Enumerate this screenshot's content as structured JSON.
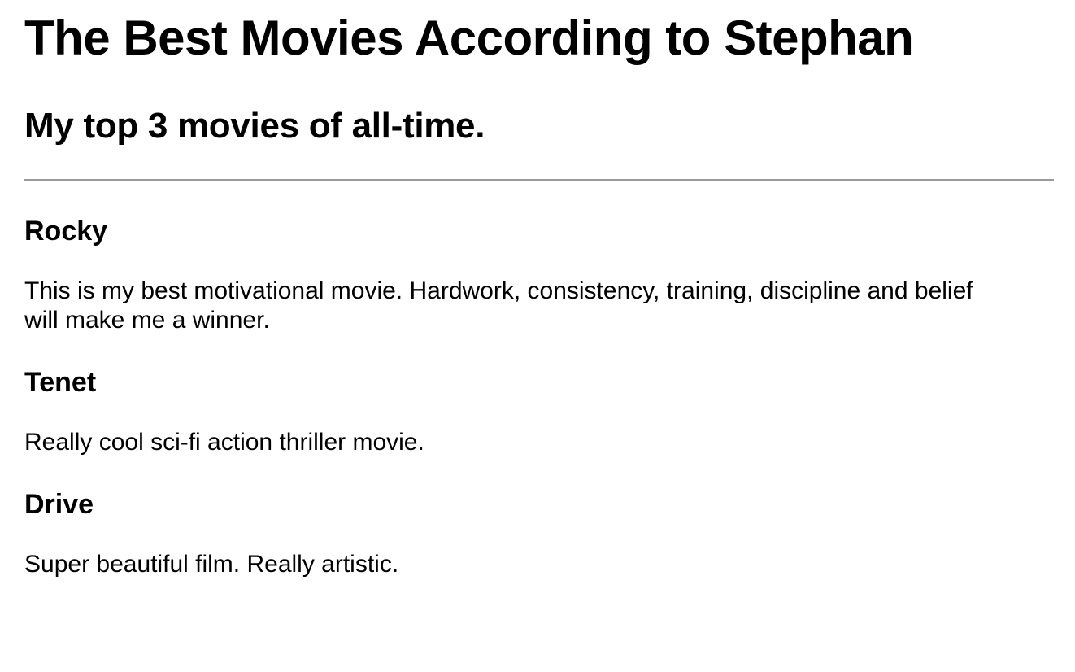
{
  "header": {
    "title": "The Best Movies According to Stephan",
    "subtitle": "My top 3 movies of all-time."
  },
  "movies": [
    {
      "title": "Rocky",
      "description": "This is my best motivational movie. Hardwork, consistency, training, discipline and belief will make me a winner."
    },
    {
      "title": "Tenet",
      "description": "Really cool sci-fi action thriller movie."
    },
    {
      "title": "Drive",
      "description": "Super beautiful film. Really artistic."
    }
  ]
}
